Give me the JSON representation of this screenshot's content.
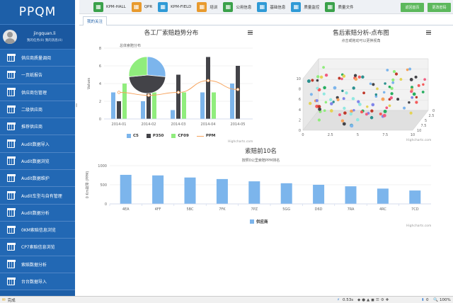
{
  "app": {
    "title": "PPQM"
  },
  "user": {
    "name": "jingquan.li",
    "links": "我的任务(0)  我的消息(0)"
  },
  "sidebar": {
    "items": [
      {
        "label": "供应商质量调阅"
      },
      {
        "label": "一页纸报告"
      },
      {
        "label": "供应商包管理"
      },
      {
        "label": "二级供应商"
      },
      {
        "label": "推荐供应商"
      },
      {
        "label": "Audit数据导入"
      },
      {
        "label": "Audit数据浏览"
      },
      {
        "label": "Audit数据维护"
      },
      {
        "label": "Audit车型与自有管理"
      },
      {
        "label": "Audit数据分析"
      },
      {
        "label": "0KM索赔信息浏览"
      },
      {
        "label": "CP7索赔信息浏览"
      },
      {
        "label": "索赔数据分析"
      },
      {
        "label": "台台数据导入"
      }
    ]
  },
  "toolbar": {
    "items": [
      {
        "label": "KPM-HALL",
        "color": "#3aa14a",
        "icon": "spreadsheet-icon"
      },
      {
        "label": "QPR",
        "color": "#e89a2e",
        "icon": "spreadsheet-icon"
      },
      {
        "label": "KPM-FIELD",
        "color": "#2f9ad6",
        "icon": "spreadsheet-icon"
      },
      {
        "label": "培训",
        "color": "#e89a2e",
        "icon": "training-icon"
      },
      {
        "label": "公用信息",
        "color": "#3aa14a",
        "icon": "info-icon"
      },
      {
        "label": "基础信息",
        "color": "#2f9ad6",
        "icon": "database-icon"
      },
      {
        "label": "质量监控",
        "color": "#2f9ad6",
        "icon": "monitor-icon"
      },
      {
        "label": "质量文件",
        "color": "#3aa14a",
        "icon": "document-icon"
      }
    ],
    "return_label": "返回首页",
    "password_label": "更改密码"
  },
  "tabs": [
    {
      "label": "我的关注"
    }
  ],
  "charts": {
    "trend": {
      "title": "各工厂索赔趋势分布",
      "credits": "Highcharts.com",
      "pie_label": "总体索赔分布"
    },
    "scatter": {
      "title": "售后索赔分析-点布图",
      "subtitle": "点击或拖动可以更换视角",
      "credits": "Highcharts.com"
    },
    "top10": {
      "title": "索赔前10名",
      "subtitle": "按照0公里索赔PPM排名",
      "credits": "Highcharts.com"
    }
  },
  "chart_data": [
    {
      "type": "bar",
      "title": "各工厂索赔趋势分布",
      "categories": [
        "2014-01",
        "2014-02",
        "2014-03",
        "2014-04",
        "2014-05"
      ],
      "ylabel": "Values",
      "ylim": [
        0,
        8
      ],
      "yticks": [
        0,
        2,
        4,
        6,
        8
      ],
      "series": [
        {
          "name": "C5",
          "color": "#7cb5ec",
          "values": [
            3,
            2,
            1,
            3,
            4
          ]
        },
        {
          "name": "P350",
          "color": "#434348",
          "values": [
            2,
            3,
            5,
            7,
            6
          ]
        },
        {
          "name": "CF09",
          "color": "#90ed7d",
          "values": [
            4,
            3,
            3,
            3,
            0
          ]
        }
      ],
      "line": {
        "name": "PPM",
        "color": "#f7a35c",
        "values": [
          3,
          2.67,
          3,
          4.33,
          3.33
        ]
      },
      "pie": {
        "title": "总体索赔分布",
        "slices": [
          {
            "name": "C5",
            "value": 13,
            "color": "#7cb5ec"
          },
          {
            "name": "P350",
            "value": 23,
            "color": "#434348"
          },
          {
            "name": "CF09",
            "value": 13,
            "color": "#90ed7d"
          }
        ]
      },
      "legend": "bottom"
    },
    {
      "type": "scatter",
      "title": "售后索赔分析-点布图",
      "subtitle": "点击或拖动可以更换视角",
      "xticks": [
        0,
        2.5,
        5,
        7.5,
        10
      ],
      "yticks": [
        0,
        2,
        4,
        6,
        8,
        10
      ],
      "zticks": [
        0,
        2.5,
        5,
        7.5,
        10
      ]
    },
    {
      "type": "bar",
      "title": "索赔前10名",
      "subtitle": "按照0公里索赔PPM排名",
      "categories": [
        "4EA",
        "4FF",
        "5BC",
        "7FK",
        "7PZ",
        "5GG",
        "D6D",
        "7RA",
        "4RC",
        "7CD"
      ],
      "ylabel": "0 Km故障 (PPM)",
      "ylim": [
        0,
        1000
      ],
      "yticks": [
        0,
        500,
        1000
      ],
      "series": [
        {
          "name": "供应商",
          "color": "#7cb5ec",
          "values": [
            760,
            745,
            690,
            650,
            590,
            540,
            500,
            460,
            400,
            350
          ]
        }
      ],
      "legend": "bottom"
    }
  ],
  "status": {
    "left": "完成",
    "timing": "0.53s",
    "count": "0",
    "zoom": "100%"
  }
}
